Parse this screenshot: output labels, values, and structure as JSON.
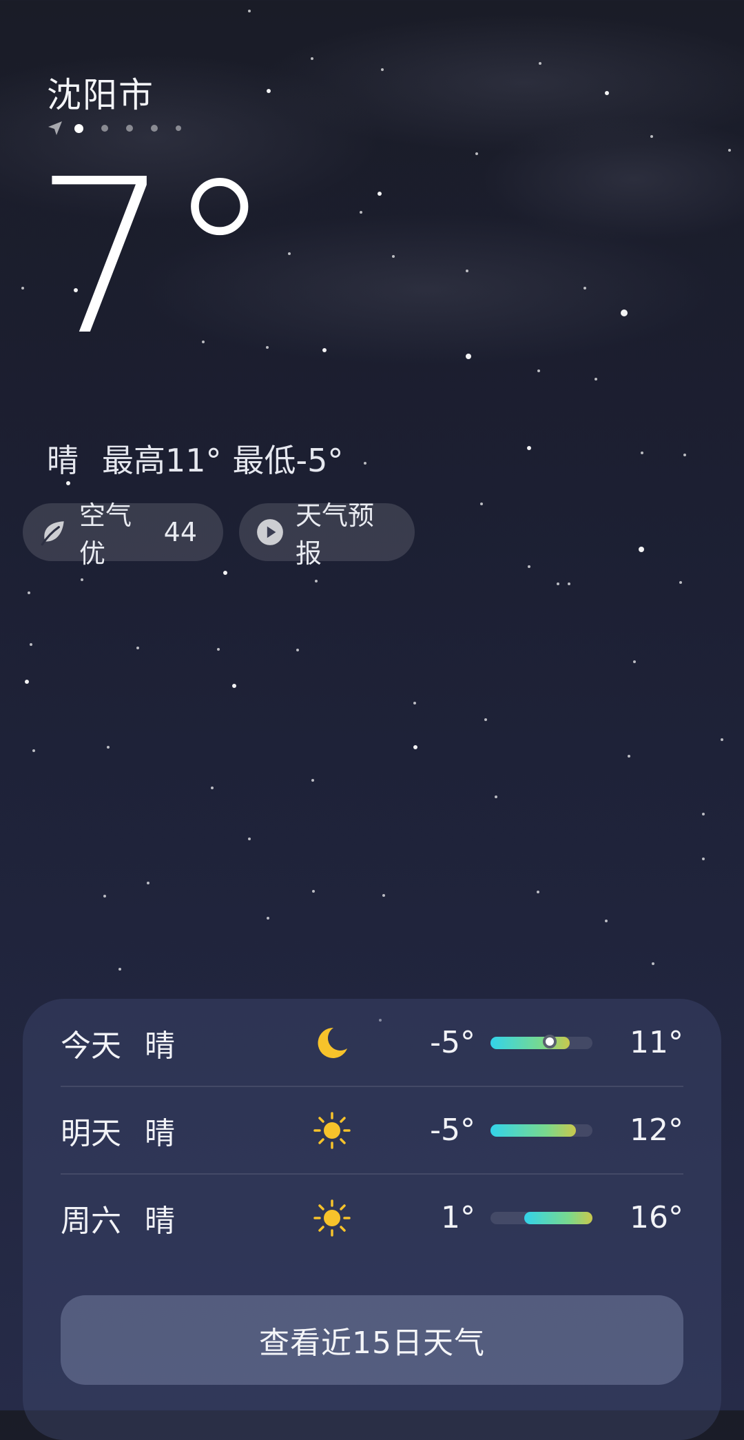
{
  "location": {
    "city": "沈阳市"
  },
  "current": {
    "temperature": "7°",
    "condition": "晴",
    "high": "最高11°",
    "low": "最低-5°"
  },
  "chips": {
    "air_quality_label": "空气优",
    "air_quality_value": "44",
    "forecast_label": "天气预报"
  },
  "forecast": [
    {
      "day": "今天",
      "condition": "晴",
      "icon": "moon-icon",
      "low": "-5°",
      "high": "11°",
      "range": [
        0.0,
        0.78
      ],
      "current_mark": 0.57
    },
    {
      "day": "明天",
      "condition": "晴",
      "icon": "sun-icon",
      "low": "-5°",
      "high": "12°",
      "range": [
        0.0,
        0.84
      ]
    },
    {
      "day": "周六",
      "condition": "晴",
      "icon": "sun-icon",
      "low": "1°",
      "high": "16°",
      "range": [
        0.33,
        1.0
      ]
    }
  ],
  "more_button": "查看近15日天气",
  "colors": {
    "sun": "#f7c32b",
    "moon": "#f7c32b",
    "bar_start": "#33d3ea",
    "bar_mid": "#79d98d",
    "bar_end": "#c9c84d"
  }
}
